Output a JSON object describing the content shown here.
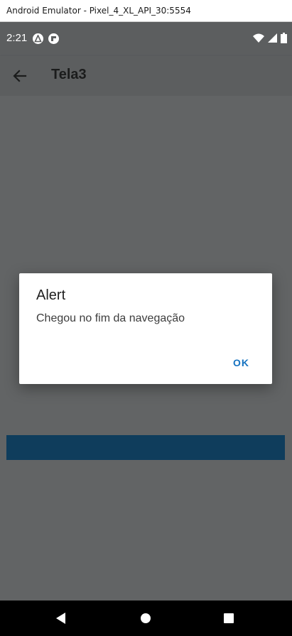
{
  "window": {
    "title": "Android Emulator - Pixel_4_XL_API_30:5554"
  },
  "status_bar": {
    "time": "2:21",
    "notification_icons": [
      "react-native-icon",
      "fb-icon"
    ],
    "right_icons": [
      "wifi-icon",
      "cell-signal-icon",
      "battery-icon"
    ]
  },
  "app_bar": {
    "title": "Tela3",
    "back_icon": "arrow-back-icon"
  },
  "dialog": {
    "title": "Alert",
    "message": "Chegou no fim da navegação",
    "ok_label": "OK"
  },
  "nav_bar": {
    "icons": [
      "back-triangle-icon",
      "home-circle-icon",
      "recents-square-icon"
    ]
  },
  "colors": {
    "scrim": "#5c5e5f",
    "accent": "#1673c1",
    "underlying_button": "#0f3d5c"
  }
}
